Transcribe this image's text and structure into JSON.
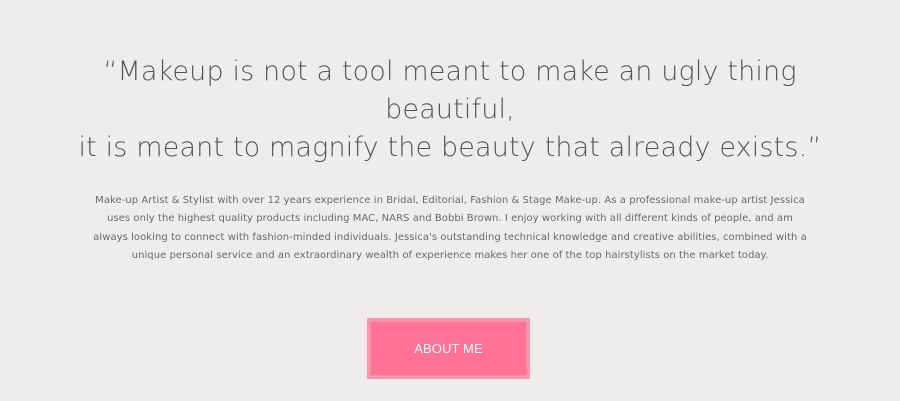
{
  "quote": {
    "lines": [
      "“Makeup is not a tool meant to make an ugly thing",
      "beautiful,",
      "it is meant to magnify the beauty that already exists.”"
    ]
  },
  "bio": {
    "text": "Make-up Artist & Stylist with over 12 years experience in Bridal, Editorial, Fashion & Stage Make-up. As a professional make-up artist Jessica uses only the highest quality products including MAC, NARS and Bobbi Brown. I enjoy working with all different kinds of people, and am always looking to connect with fashion-minded individuals. Jessica's outstanding technical knowledge and creative abilities, combined with a unique personal service and an extraordinary wealth of experience makes her one of the top hairstylists on the market today."
  },
  "button": {
    "label": "ABOUT ME"
  },
  "colors": {
    "background": "#efedec",
    "text": "#5f5e5f",
    "button_fill": "#fd7295",
    "button_border": "#fa98b1",
    "button_text": "#ffffff"
  }
}
